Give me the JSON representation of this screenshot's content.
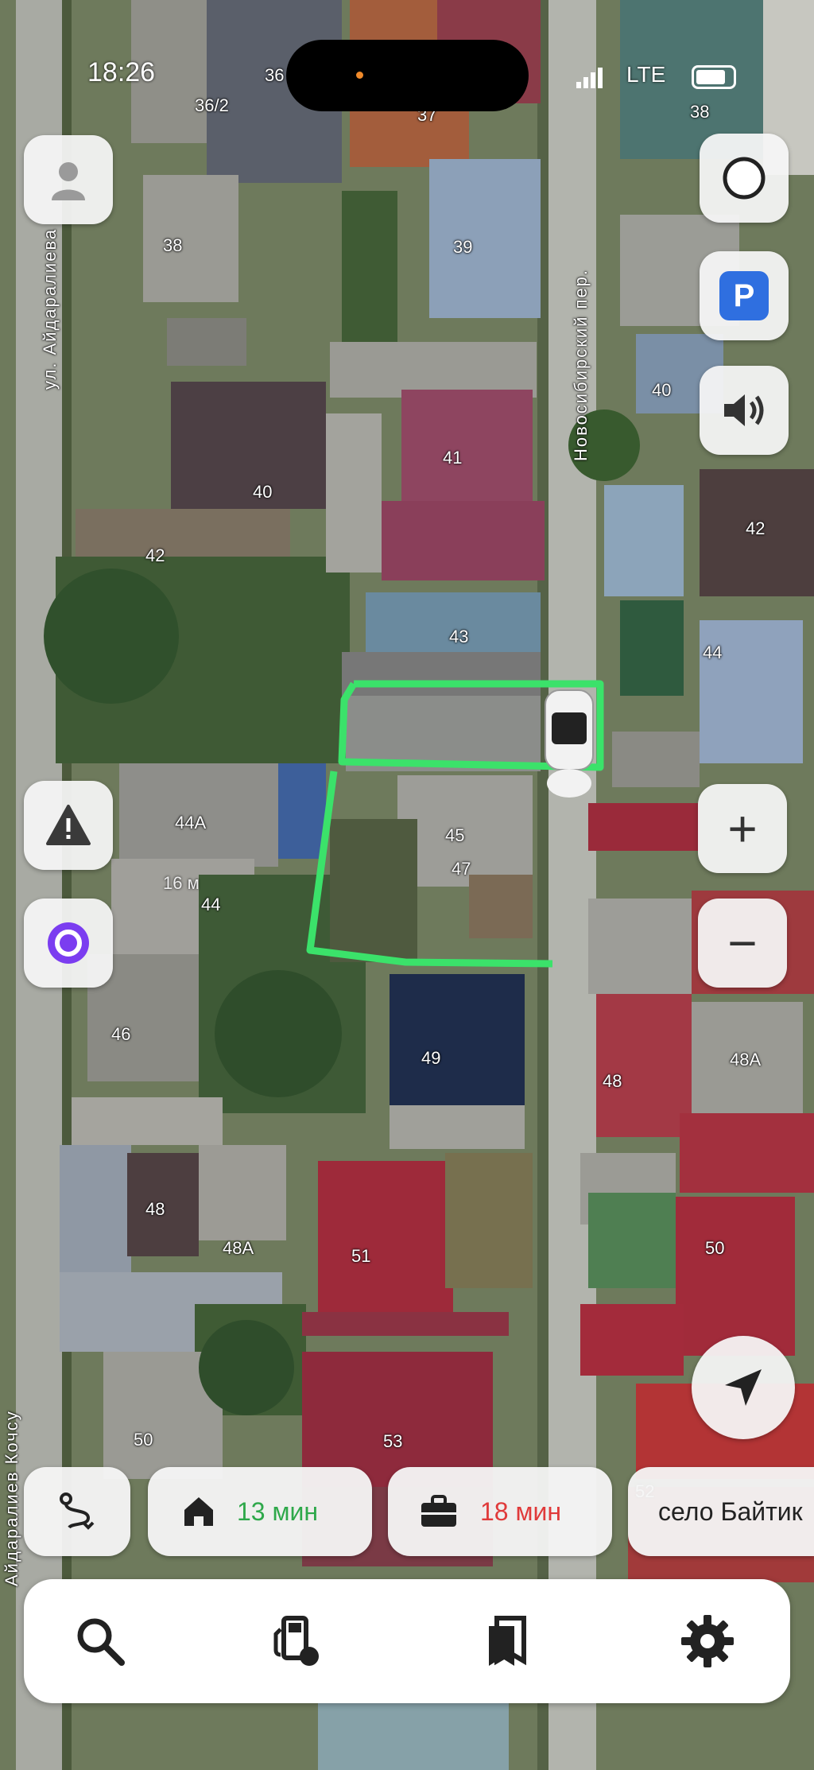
{
  "status_bar": {
    "time": "18:26",
    "network": "LTE"
  },
  "map": {
    "streets": [
      {
        "id": "aydaralieva",
        "label": "ул. Айдаралиева"
      },
      {
        "id": "novosibirsky",
        "label": "Новосибирский пер."
      },
      {
        "id": "kochsu",
        "label": "Айдаралиев Кочсу"
      }
    ],
    "buildings": [
      "36/2",
      "36",
      "37",
      "38",
      "38",
      "39",
      "40",
      "40",
      "41",
      "42",
      "42",
      "43",
      "44",
      "44A",
      "44",
      "45",
      "47",
      "46",
      "49",
      "48",
      "48A",
      "48",
      "48A",
      "50",
      "51",
      "50",
      "53",
      "52"
    ],
    "distance_label": "16 м",
    "highlight_color": "#3be26a"
  },
  "controls": {
    "profile": "profile-icon",
    "alice": "alice-icon",
    "parking": "P",
    "sound": "speaker-icon",
    "alert": "alert-icon",
    "zoom_in": "+",
    "zoom_out": "−",
    "locate": "navigation-arrow-icon"
  },
  "shortcuts": {
    "route_icon": "route-icon",
    "home": {
      "icon": "home-icon",
      "time": "13 мин",
      "color": "#2ea84a"
    },
    "work": {
      "icon": "briefcase-icon",
      "time": "18 мин",
      "color": "#e03a3a"
    },
    "place": {
      "label": "село Байтик"
    }
  },
  "bottom_nav": [
    "search-icon",
    "fuel-icon",
    "bookmarks-icon",
    "settings-icon"
  ]
}
